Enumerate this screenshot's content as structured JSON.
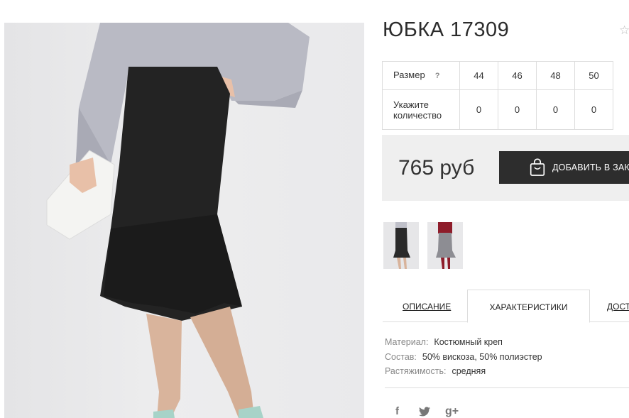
{
  "product": {
    "title": "ЮБКА 17309",
    "price": "765 руб",
    "add_to_cart_label": "ДОБАВИТЬ В ЗАКАЗ",
    "favorite_icon": "star-icon"
  },
  "size_table": {
    "size_label": "Размер",
    "help": "?",
    "qty_label": "Укажите количество",
    "sizes": [
      "44",
      "46",
      "48",
      "50"
    ],
    "quantities": [
      "0",
      "0",
      "0",
      "0"
    ]
  },
  "tabs": [
    {
      "label": "ОПИСАНИЕ",
      "active": false
    },
    {
      "label": "ХАРАКТЕРИСТИКИ",
      "active": true
    },
    {
      "label": "ДОСТАВКА",
      "active": false
    }
  ],
  "specs": [
    {
      "key": "Материал:",
      "value": "Костюмный креп"
    },
    {
      "key": "Состав:",
      "value": "50% вискоза, 50% полиэстер"
    },
    {
      "key": "Растяжимость:",
      "value": "средняя"
    }
  ],
  "social": {
    "facebook": "f",
    "twitter": "twitter-icon",
    "gplus": "g+"
  },
  "colors": {
    "button_bg": "#2d2d2d",
    "buybox_bg": "#efefef",
    "border": "#dddddd"
  }
}
